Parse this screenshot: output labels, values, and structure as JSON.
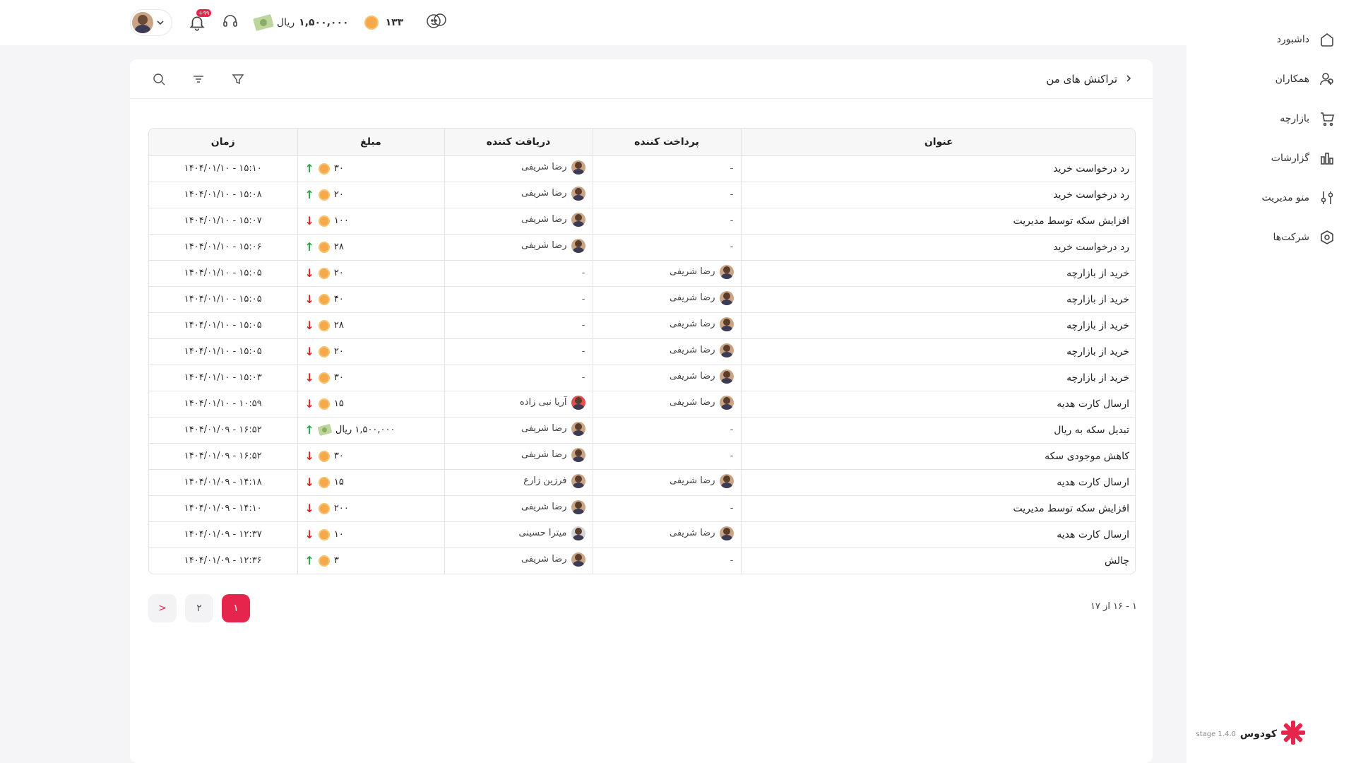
{
  "sidebar": {
    "items": [
      {
        "label": "داشبورد",
        "icon": "home-icon"
      },
      {
        "label": "همکاران",
        "icon": "users-icon"
      },
      {
        "label": "بازارچه",
        "icon": "cart-icon"
      },
      {
        "label": "گزارشات",
        "icon": "chart-icon"
      },
      {
        "label": "منو مدیریت",
        "icon": "sliders-icon"
      },
      {
        "label": "شرکت‌ها",
        "icon": "hexagon-icon"
      }
    ],
    "brand_name": "کودوس",
    "brand_stage": "stage 1.4.0"
  },
  "header": {
    "notifications_badge": "+۹۹",
    "rial_amount": "۱,۵۰۰,۰۰۰",
    "rial_unit": "ریال",
    "coin_amount": "۱۳۳"
  },
  "page": {
    "breadcrumb": "تراکنش های من"
  },
  "table": {
    "headers": [
      "عنوان",
      "پرداخت کننده",
      "دریافت کننده",
      "مبلغ",
      "زمان"
    ],
    "rows": [
      {
        "title": "رد درخواست خرید",
        "payer": "-",
        "receiver": "رضا شریفی",
        "direction": "up",
        "currency": "coin",
        "amount": "۳۰",
        "time": "۱۴۰۴/۰۱/۱۰ - ۱۵:۱۰"
      },
      {
        "title": "رد درخواست خرید",
        "payer": "-",
        "receiver": "رضا شریفی",
        "direction": "up",
        "currency": "coin",
        "amount": "۲۰",
        "time": "۱۴۰۴/۰۱/۱۰ - ۱۵:۰۸"
      },
      {
        "title": "افزایش سکه توسط مدیریت",
        "payer": "-",
        "receiver": "رضا شریفی",
        "direction": "down",
        "currency": "coin",
        "amount": "۱۰۰",
        "time": "۱۴۰۴/۰۱/۱۰ - ۱۵:۰۷"
      },
      {
        "title": "رد درخواست خرید",
        "payer": "-",
        "receiver": "رضا شریفی",
        "direction": "up",
        "currency": "coin",
        "amount": "۲۸",
        "time": "۱۴۰۴/۰۱/۱۰ - ۱۵:۰۶"
      },
      {
        "title": "خرید از بازارچه",
        "payer": "رضا شریفی",
        "receiver": "-",
        "direction": "down",
        "currency": "coin",
        "amount": "۲۰",
        "time": "۱۴۰۴/۰۱/۱۰ - ۱۵:۰۵"
      },
      {
        "title": "خرید از بازارچه",
        "payer": "رضا شریفی",
        "receiver": "-",
        "direction": "down",
        "currency": "coin",
        "amount": "۴۰",
        "time": "۱۴۰۴/۰۱/۱۰ - ۱۵:۰۵"
      },
      {
        "title": "خرید از بازارچه",
        "payer": "رضا شریفی",
        "receiver": "-",
        "direction": "down",
        "currency": "coin",
        "amount": "۲۸",
        "time": "۱۴۰۴/۰۱/۱۰ - ۱۵:۰۵"
      },
      {
        "title": "خرید از بازارچه",
        "payer": "رضا شریفی",
        "receiver": "-",
        "direction": "down",
        "currency": "coin",
        "amount": "۲۰",
        "time": "۱۴۰۴/۰۱/۱۰ - ۱۵:۰۵"
      },
      {
        "title": "خرید از بازارچه",
        "payer": "رضا شریفی",
        "receiver": "-",
        "direction": "down",
        "currency": "coin",
        "amount": "۳۰",
        "time": "۱۴۰۴/۰۱/۱۰ - ۱۵:۰۳"
      },
      {
        "title": "ارسال کارت هدیه",
        "payer": "رضا شریفی",
        "receiver": "آریا نبی زاده",
        "direction": "down",
        "currency": "coin",
        "amount": "۱۵",
        "time": "۱۴۰۴/۰۱/۱۰ - ۱۰:۵۹"
      },
      {
        "title": "تبدیل سکه به ریال",
        "payer": "-",
        "receiver": "رضا شریفی",
        "direction": "up",
        "currency": "rial",
        "amount": "۱,۵۰۰,۰۰۰ ریال",
        "time": "۱۴۰۴/۰۱/۰۹ - ۱۶:۵۲"
      },
      {
        "title": "کاهش موجودی سکه",
        "payer": "-",
        "receiver": "رضا شریفی",
        "direction": "down",
        "currency": "coin",
        "amount": "۳۰",
        "time": "۱۴۰۴/۰۱/۰۹ - ۱۶:۵۲"
      },
      {
        "title": "ارسال کارت هدیه",
        "payer": "رضا شریفی",
        "receiver": "فرزین زارع",
        "direction": "down",
        "currency": "coin",
        "amount": "۱۵",
        "time": "۱۴۰۴/۰۱/۰۹ - ۱۴:۱۸"
      },
      {
        "title": "افزایش سکه توسط مدیریت",
        "payer": "-",
        "receiver": "رضا شریفی",
        "direction": "down",
        "currency": "coin",
        "amount": "۲۰۰",
        "time": "۱۴۰۴/۰۱/۰۹ - ۱۴:۱۰"
      },
      {
        "title": "ارسال کارت هدیه",
        "payer": "رضا شریفی",
        "receiver": "میترا حسینی",
        "direction": "down",
        "currency": "coin",
        "amount": "۱۰",
        "time": "۱۴۰۴/۰۱/۰۹ - ۱۲:۳۷"
      },
      {
        "title": "چالش",
        "payer": "-",
        "receiver": "رضا شریفی",
        "direction": "up",
        "currency": "coin",
        "amount": "۳",
        "time": "۱۴۰۴/۰۱/۰۹ - ۱۲:۳۶"
      }
    ]
  },
  "pagination": {
    "range_text": "۱ - ۱۶ از ۱۷",
    "pages": [
      "۱",
      "۲"
    ],
    "active_page": "۱",
    "next_label": ">"
  },
  "colors": {
    "accent": "#e6254c",
    "up": "#28a745",
    "down": "#e02424",
    "coin": "#f5a94b"
  }
}
